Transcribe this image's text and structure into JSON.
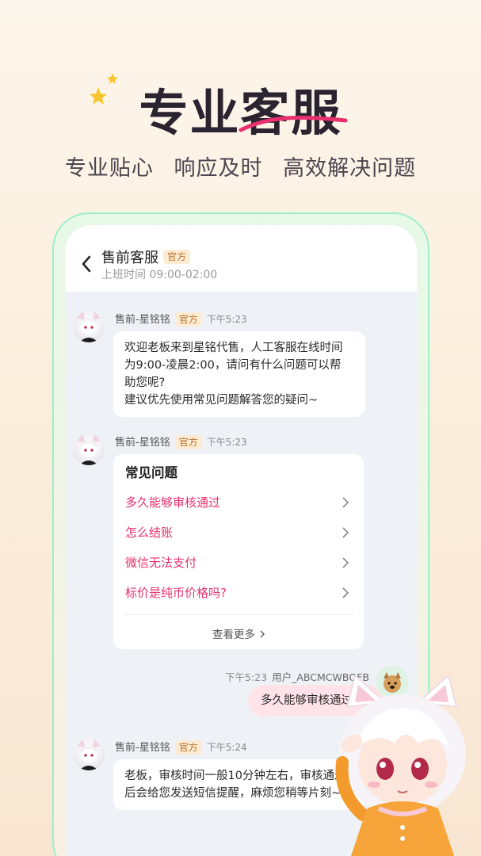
{
  "hero": {
    "title": "专业客服",
    "subtitles": [
      "专业贴心",
      "响应及时",
      "高效解决问题"
    ]
  },
  "chat": {
    "title": "售前客服",
    "official_tag": "官方",
    "work_hours": "上班时间 09:00-02:00",
    "messages": [
      {
        "sender": "售前-星铭铭",
        "tag": "官方",
        "time": "下午5:23",
        "lines": [
          "欢迎老板来到星铭代售，人工客服在线时间",
          "为9:00-凌晨2:00，请问有什么问题可以帮",
          "助您呢?",
          "建议优先使用常见问题解答您的疑问~"
        ]
      },
      {
        "sender": "售前-星铭铭",
        "tag": "官方",
        "time": "下午5:23",
        "faq": {
          "title": "常见问题",
          "items": [
            "多久能够审核通过",
            "怎么结账",
            "微信无法支付",
            "标价是纯币价格吗?"
          ],
          "more": "查看更多"
        }
      },
      {
        "time": "下午5:23",
        "user": "用户_ABCMCWBQFB",
        "text": "多久能够审核通过"
      },
      {
        "sender": "售前-星铭铭",
        "tag": "官方",
        "time": "下午5:24",
        "lines": [
          "老板，审核时间一般10分钟左右，审核通过",
          "后会给您发送短信提醒，麻烦您稍等片刻~"
        ]
      }
    ]
  },
  "colors": {
    "accent_pink": "#e8306e",
    "frame_green": "#9df0c9",
    "tag_text": "#b8732e",
    "tag_bg": "#fdebd3"
  }
}
